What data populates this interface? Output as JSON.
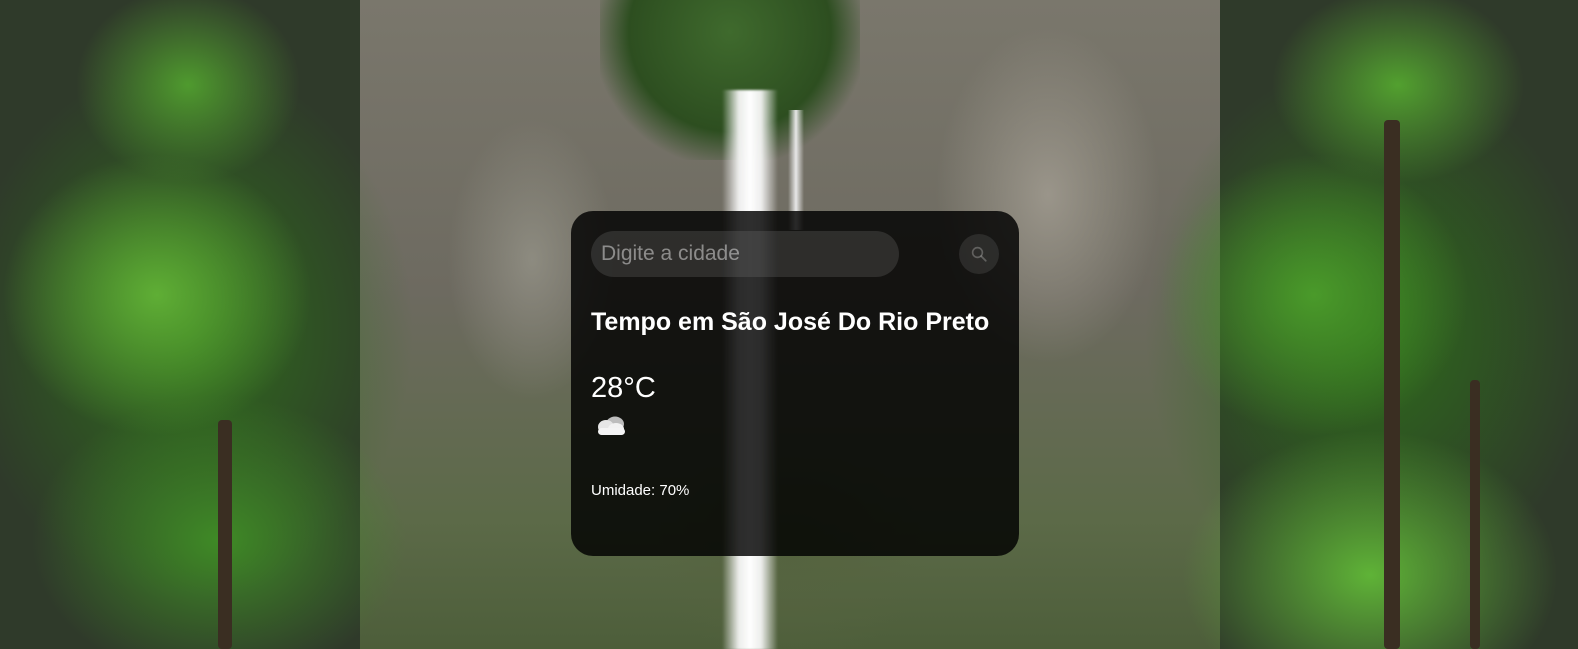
{
  "search": {
    "placeholder": "Digite a cidade",
    "button_icon": "search-icon"
  },
  "weather": {
    "title": "Tempo em São José Do Rio Preto",
    "temperature": "28°C",
    "condition_icon": "cloud-icon",
    "humidity": "Umidade: 70%"
  },
  "colors": {
    "card_background": "#000000",
    "text": "#ffffff"
  }
}
